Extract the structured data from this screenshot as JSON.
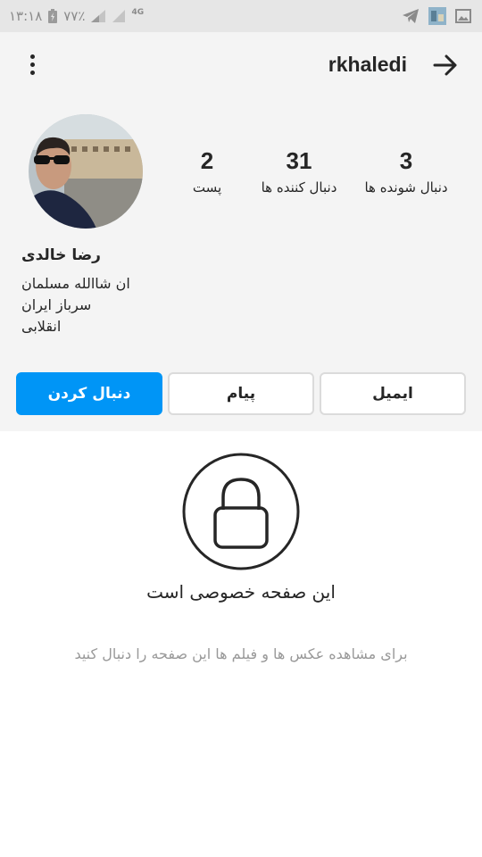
{
  "status_bar": {
    "time": "۱۳:۱۸",
    "battery": "۷۷٪",
    "network": "4G"
  },
  "header": {
    "username": "rkhaledi"
  },
  "stats": {
    "posts": {
      "count": "2",
      "label": "پست"
    },
    "followers": {
      "count": "31",
      "label": "دنبال کننده ها"
    },
    "following": {
      "count": "3",
      "label": "دنبال شونده ها"
    }
  },
  "profile": {
    "full_name": "رضا خالدی",
    "bio_lines": [
      "ان شاالله مسلمان",
      "سرباز ایران",
      "انقلابی"
    ]
  },
  "actions": {
    "follow_label": "دنبال کردن",
    "message_label": "پیام",
    "email_label": "ایمیل"
  },
  "private": {
    "title": "این صفحه خصوصی است",
    "subtitle": "برای مشاهده عکس ها و فیلم ها این صفحه را دنبال کنید"
  },
  "colors": {
    "accent": "#0095f6",
    "header_bg": "#f4f4f4",
    "status_bg": "#e6e6e6"
  },
  "icons": {
    "menu": "more-vertical-icon",
    "back": "arrow-right-icon",
    "lock": "lock-icon"
  }
}
